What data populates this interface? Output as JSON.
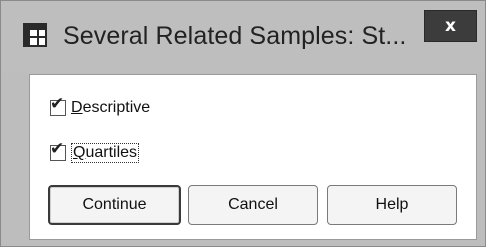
{
  "window": {
    "title": "Several Related Samples: St...",
    "close_glyph": "x",
    "app_icon": "table-grid-icon"
  },
  "options": [
    {
      "label_mnemonic": "D",
      "label_rest": "escriptive",
      "checked": true
    },
    {
      "label_mnemonic": "Q",
      "label_rest": "uartiles",
      "checked": true
    }
  ],
  "buttons": {
    "continue": "Continue",
    "cancel": "Cancel",
    "help": "Help"
  },
  "colors": {
    "titlebar": "#bebebe",
    "close_button": "#3c3c3c",
    "content_background": "#ffffff"
  }
}
